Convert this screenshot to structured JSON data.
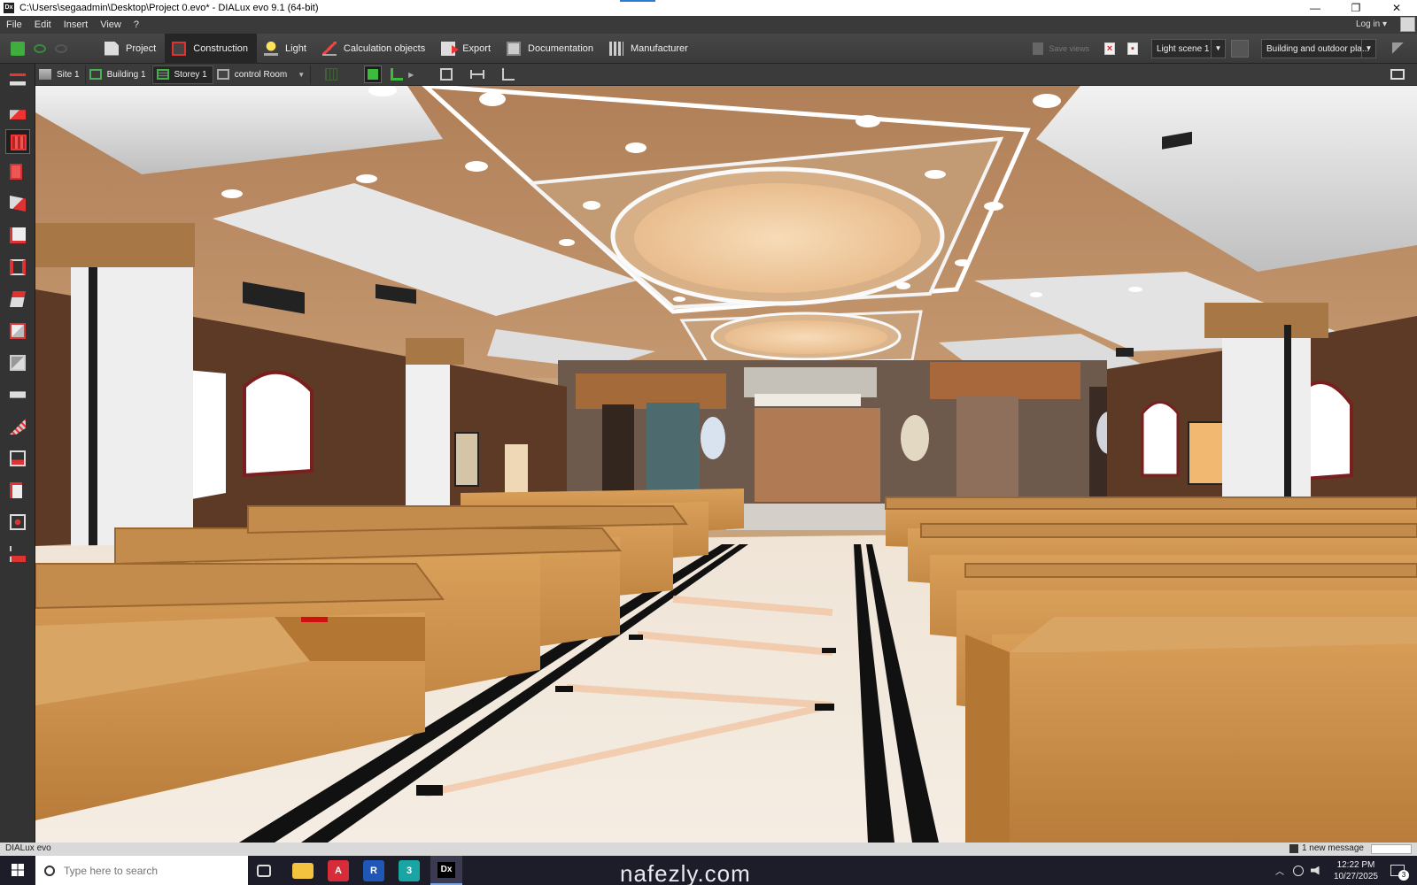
{
  "window": {
    "title": "C:\\Users\\segaadmin\\Desktop\\Project 0.evo* - DIALux evo 9.1  (64-bit)",
    "app_icon": "Dx",
    "controls": [
      "—",
      "❐",
      "✕"
    ]
  },
  "menu": {
    "items": [
      "File",
      "Edit",
      "Insert",
      "View",
      "?"
    ],
    "login": "Log in ▾"
  },
  "ribbon": {
    "tabs": [
      {
        "label": "Project",
        "icon": "document-icon"
      },
      {
        "label": "Construction",
        "icon": "construction-icon",
        "active": true
      },
      {
        "label": "Light",
        "icon": "lamp-icon"
      },
      {
        "label": "Calculation objects",
        "icon": "calculation-icon"
      },
      {
        "label": "Export",
        "icon": "export-icon"
      },
      {
        "label": "Documentation",
        "icon": "documentation-icon"
      },
      {
        "label": "Manufacturer",
        "icon": "manufacturer-icon"
      }
    ],
    "disabled_action": "Save views",
    "light_scene": "Light scene 1",
    "view_mode": "Building and outdoor pla..."
  },
  "toolbar2": {
    "crumbs": [
      "Site 1",
      "Building 1",
      "Storey 1",
      "control Room"
    ],
    "active_crumb": "Storey 1"
  },
  "status": {
    "app": "DIALux evo",
    "message": "1 new message"
  },
  "taskbar": {
    "search_placeholder": "Type here to search",
    "apps": [
      "A",
      "R",
      "3",
      "Dx"
    ],
    "watermark": "nafezly.com",
    "time": "12:22 PM",
    "date": "10/27/2025",
    "notifications": "3"
  },
  "colors": {
    "accent_red": "#e33333",
    "accent_green": "#3dbb3d",
    "ceiling_brown": "#b98a62",
    "pew_wood": "#c98f4a"
  }
}
